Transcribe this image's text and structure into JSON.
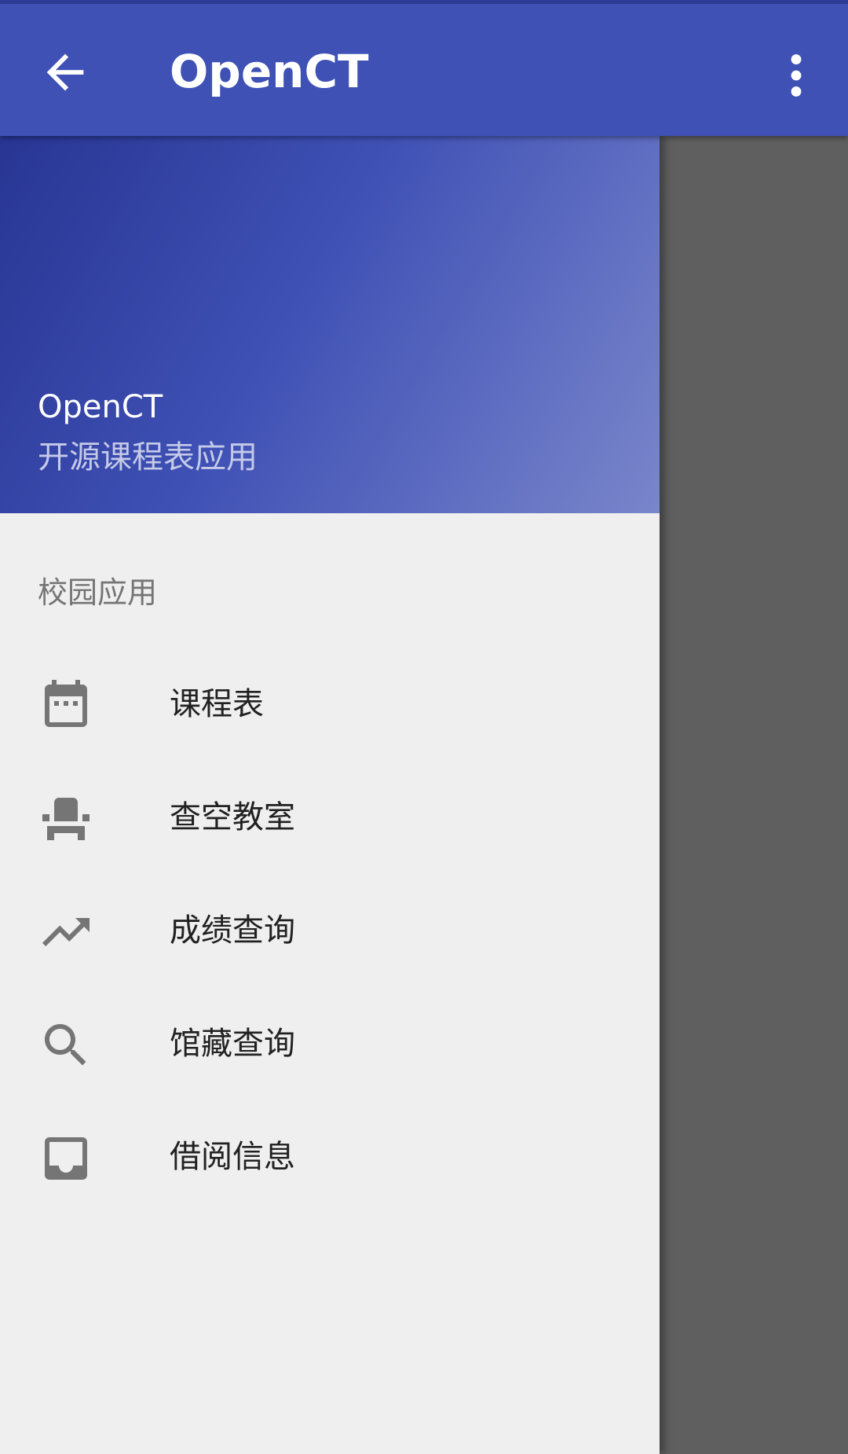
{
  "app_bar": {
    "title": "OpenCT",
    "back_icon": "arrow-back-icon",
    "menu_icon": "more-vert-icon",
    "color": "#3f51b5"
  },
  "drawer": {
    "header": {
      "app_name": "OpenCT",
      "subtitle": "开源课程表应用"
    },
    "section_label": "校园应用",
    "items": [
      {
        "label": "课程表",
        "icon": "calendar-icon"
      },
      {
        "label": "查空教室",
        "icon": "seat-icon"
      },
      {
        "label": "成绩查询",
        "icon": "trending-up-icon"
      },
      {
        "label": "馆藏查询",
        "icon": "search-icon"
      },
      {
        "label": "借阅信息",
        "icon": "inbox-icon"
      }
    ]
  }
}
